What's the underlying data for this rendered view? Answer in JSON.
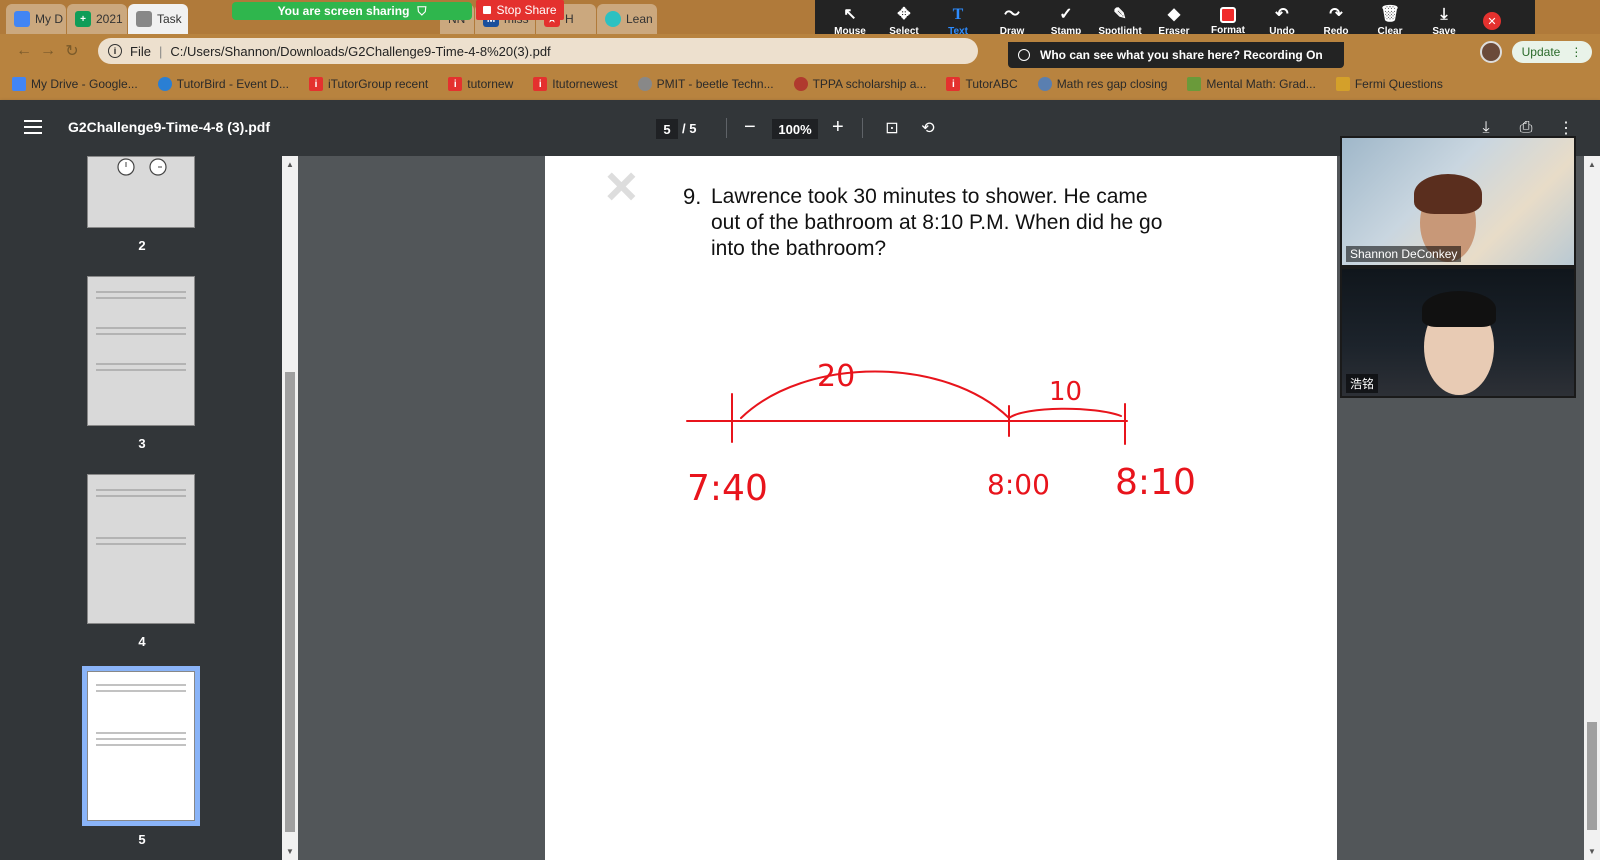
{
  "browser": {
    "tabs": [
      {
        "label": "My D",
        "color": "#4285f4"
      },
      {
        "label": "2021",
        "color": "#0f9d58"
      },
      {
        "label": "Task",
        "color": "#888888"
      },
      {
        "label": "NN",
        "color": "#666666"
      },
      {
        "label": "miss",
        "color": "#1a4f9c"
      },
      {
        "label": "H",
        "color": "#e4312e"
      },
      {
        "label": "Lean",
        "color": "#2cc1c1"
      }
    ],
    "nav": {
      "back": "←",
      "forward": "→",
      "reload": "↻"
    },
    "address": {
      "scheme": "File",
      "url": "C:/Users/Shannon/Downloads/G2Challenge9-Time-4-8%20(3).pdf"
    },
    "update_label": "Update",
    "bookmarks": [
      {
        "label": "My Drive - Google...",
        "color": "#4285f4"
      },
      {
        "label": "TutorBird - Event D...",
        "color": "#2a7fd4"
      },
      {
        "label": "iTutorGroup recent",
        "color": "#e4312e"
      },
      {
        "label": "tutornew",
        "color": "#e4312e"
      },
      {
        "label": "Itutornewest",
        "color": "#e4312e"
      },
      {
        "label": "PMIT - beetle Techn...",
        "color": "#888888"
      },
      {
        "label": "TPPA scholarship a...",
        "color": "#b03a2e"
      },
      {
        "label": "TutorABC",
        "color": "#e4312e"
      },
      {
        "label": "Math res gap closing",
        "color": "#5a7fb0"
      },
      {
        "label": "Mental Math: Grad...",
        "color": "#6a9a3a"
      },
      {
        "label": "Fermi Questions",
        "color": "#d4a02a"
      }
    ]
  },
  "zoom_share": {
    "sharing_label": "You are screen sharing",
    "stop_label": "Stop Share",
    "banner_text": "Who can see what you share here? Recording On",
    "tools": [
      {
        "label": "Mouse",
        "icon": "↖"
      },
      {
        "label": "Select",
        "icon": "✥"
      },
      {
        "label": "Text",
        "icon": "T"
      },
      {
        "label": "Draw",
        "icon": "〜"
      },
      {
        "label": "Stamp",
        "icon": "✓"
      },
      {
        "label": "Spotlight",
        "icon": "✎"
      },
      {
        "label": "Eraser",
        "icon": "◆"
      },
      {
        "label": "Format",
        "icon": ""
      },
      {
        "label": "Undo",
        "icon": "↶"
      },
      {
        "label": "Redo",
        "icon": "↷"
      },
      {
        "label": "Clear",
        "icon": "🗑"
      },
      {
        "label": "Save",
        "icon": "⤓"
      }
    ],
    "accent_selected": "#2d8cff",
    "format_color": "#f02b2b"
  },
  "pdf": {
    "title": "G2Challenge9-Time-4-8 (3).pdf",
    "page_current": "5",
    "page_total": "/ 5",
    "zoom": "100%",
    "thumbnails": [
      {
        "num": "2"
      },
      {
        "num": "3"
      },
      {
        "num": "4"
      },
      {
        "num": "5",
        "selected": true
      }
    ],
    "question": {
      "number": "9.",
      "text": "Lawrence took 30 minutes to shower. He came out of the bathroom at 8:10 P.M. When did he go into the bathroom?"
    },
    "annotation": {
      "color": "#e8141c",
      "label_arc_left": "20",
      "label_arc_right": "10",
      "time_start": "7:40",
      "time_mid": "8:00",
      "time_end": "8:10"
    }
  },
  "participants": [
    {
      "name": "Shannon DeConkey"
    },
    {
      "name": "浩铭"
    }
  ]
}
